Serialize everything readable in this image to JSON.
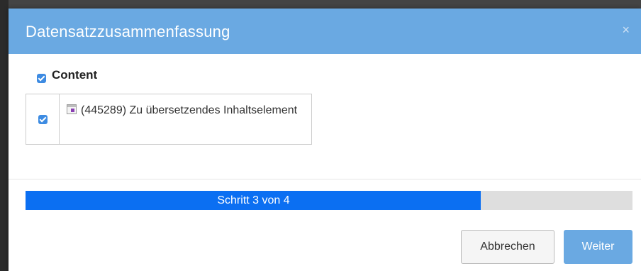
{
  "modal": {
    "title": "Datensatzzusammenfassung",
    "close_icon": "×"
  },
  "content_group": {
    "label": "Content",
    "checked": true,
    "records": [
      {
        "checked": true,
        "icon": "content-element-icon",
        "text": "(445289) Zu übersetzendes Inhaltselement"
      }
    ]
  },
  "progress": {
    "label": "Schritt 3 von 4",
    "fraction": 0.75,
    "fill_color": "#0b6ff2",
    "track_color": "#dedede"
  },
  "buttons": {
    "cancel_label": "Abbrechen",
    "next_label": "Weiter"
  },
  "colors": {
    "header": "#6aa9e2",
    "checkbox": "#3d8be2"
  }
}
